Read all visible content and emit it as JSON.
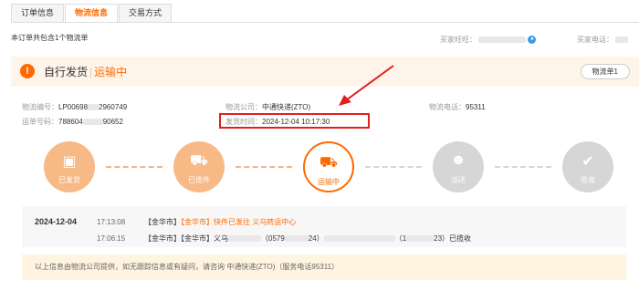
{
  "tabs": [
    {
      "label": "订单信息"
    },
    {
      "label": "物流信息"
    },
    {
      "label": "交易方式"
    }
  ],
  "summary": "本订单共包含1个物流单",
  "buyer": {
    "wangwang_label": "买家旺旺：",
    "phone_label": "买家电话："
  },
  "status": {
    "title": "自行发货",
    "state": "运输中",
    "logistics_button": "物流单1"
  },
  "fields": {
    "logistics_no_label": "物流编号：",
    "logistics_no_a": "LP00698",
    "logistics_no_b": "2960749",
    "waybill_label": "运单号码：",
    "waybill_a": "788604",
    "waybill_b": "90652",
    "company_label": "物流公司：",
    "company": "中通快递(ZTO)",
    "ship_time_label": "发货时间：",
    "ship_time": "2024-12-04 10:17:30",
    "phone_label": "物流电话：",
    "phone": "95311"
  },
  "steps": [
    {
      "label": "已发货",
      "icon": "package-icon",
      "glyph": "▣"
    },
    {
      "label": "已揽件",
      "icon": "cart-icon",
      "glyph": "⛟"
    },
    {
      "label": "运输中",
      "icon": "truck-icon",
      "glyph": "⛟"
    },
    {
      "label": "派送",
      "icon": "courier-icon",
      "glyph": "☻"
    },
    {
      "label": "签收",
      "icon": "sign-icon",
      "glyph": "✔"
    }
  ],
  "tracking": {
    "date": "2024-12-04",
    "rows": [
      {
        "time": "17:13:08",
        "city": "【金华市】",
        "city2": "【金华市】",
        "text": "快件已发往 义乌转运中心"
      },
      {
        "time": "17:06:15",
        "city": "【金华市】",
        "city2": "【金华市】",
        "text_a": "义乌",
        "text_b": "（0579",
        "text_c": "24）",
        "text_d": "（1",
        "text_e": "23）已揽收"
      }
    ]
  },
  "notice": "以上信息由物流公司提供，如无跟踪信息或有疑问，请咨询 中通快递(ZTO)（服务电话95311）",
  "colors": {
    "accent": "#ff6a00",
    "highlight": "#e0211a"
  }
}
